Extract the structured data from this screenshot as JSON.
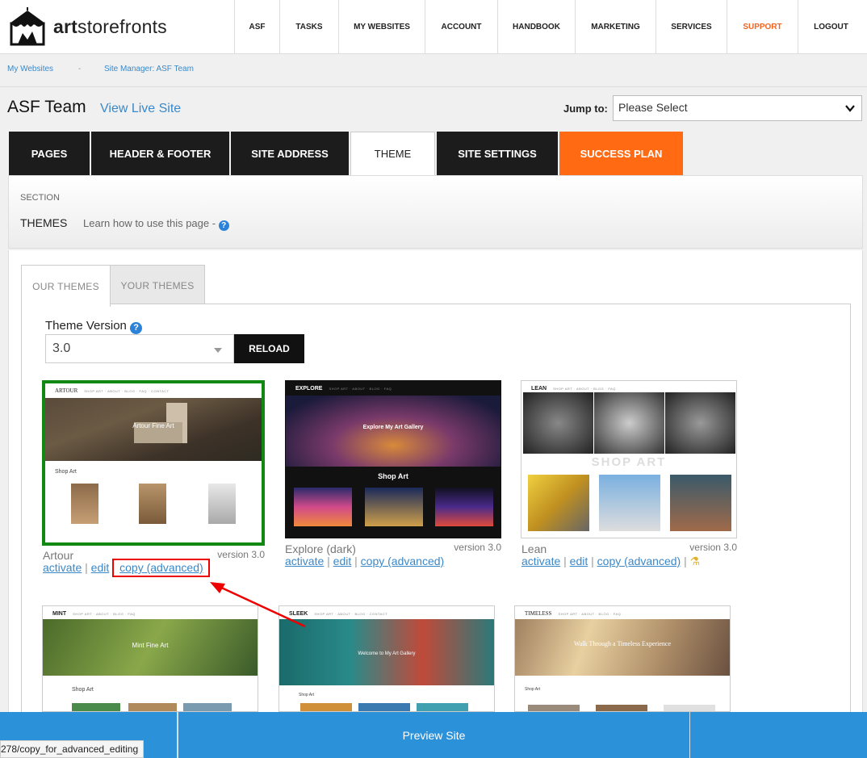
{
  "brand": {
    "name_prefix": "art",
    "name_suffix": "storefronts"
  },
  "nav": [
    {
      "label": "ASF",
      "w": 56
    },
    {
      "label": "TASKS",
      "w": 73
    },
    {
      "label": "MY WEBSITES",
      "w": 107
    },
    {
      "label": "ACCOUNT",
      "w": 90
    },
    {
      "label": "HANDBOOK",
      "w": 96
    },
    {
      "label": "MARKETING",
      "w": 100
    },
    {
      "label": "SERVICES",
      "w": 88
    },
    {
      "label": "SUPPORT",
      "w": 88
    },
    {
      "label": "LOGOUT",
      "w": 82
    }
  ],
  "breadcrumb": {
    "item1": "My Websites",
    "sep": "-",
    "item2": "Site Manager: ASF Team"
  },
  "site": {
    "title": "ASF Team",
    "live_link": "View Live Site"
  },
  "jump": {
    "label": "Jump to:",
    "value": "Please Select"
  },
  "tabs": [
    "PAGES",
    "HEADER & FOOTER",
    "SITE ADDRESS",
    "THEME",
    "SITE SETTINGS",
    "SUCCESS PLAN"
  ],
  "section": {
    "label": "SECTION",
    "name": "THEMES",
    "learn": "Learn how to use this page -"
  },
  "subtabs": {
    "ours": "OUR THEMES",
    "yours": "YOUR THEMES"
  },
  "theme_version": {
    "label": "Theme Version",
    "value": "3.0",
    "reload": "RELOAD"
  },
  "themes": [
    {
      "name": "Artour",
      "version": "version 3.0",
      "brand": "ARTOUR",
      "hero": "Artour Fine Art",
      "shop": "Shop Art",
      "activate": "activate",
      "edit": "edit",
      "copy": "copy (advanced)"
    },
    {
      "name": "Explore (dark)",
      "version": "version 3.0",
      "brand": "EXPLORE",
      "hero": "Explore My Art Gallery",
      "shop": "Shop Art",
      "activate": "activate",
      "edit": "edit",
      "copy": "copy (advanced)"
    },
    {
      "name": "Lean",
      "version": "version 3.0",
      "brand": "LEAN",
      "hero": "",
      "shop": "SHOP ART",
      "activate": "activate",
      "edit": "edit",
      "copy": "copy (advanced)"
    },
    {
      "name": "Mint",
      "brand": "MINT",
      "hero": "Mint Fine Art",
      "shop": "Shop Art"
    },
    {
      "name": "Sleek",
      "brand": "SLEEK",
      "hero": "Welcome to My Art Gallery",
      "shop": "Shop Art"
    },
    {
      "name": "Timeless",
      "brand": "TIMELESS",
      "hero": "Walk Through a Timeless Experience",
      "shop": "Shop Art"
    }
  ],
  "link_sep": "|",
  "bottom": {
    "preview": "Preview Site",
    "status_url": "278/copy_for_advanced_editing"
  },
  "colors": {
    "accent": "#3a88c8",
    "orange": "#ff6a13",
    "selected": "#118811",
    "bar": "#2b91d9"
  }
}
